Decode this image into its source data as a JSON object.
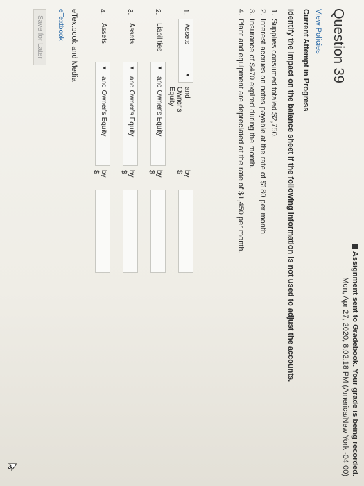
{
  "banner": {
    "line1": "Assignment sent to Gradebook. Your grade is being recorded.",
    "line2": "Mon, Apr 27, 2020, 8:02:18 PM (America/New York -04:00)"
  },
  "question": {
    "title": "Question 39",
    "view_policies": "View Policies",
    "attempt_status": "Current Attempt in Progress",
    "instruction": "Identify the impact on the balance sheet if the following information is not used to adjust the accounts.",
    "items": [
      {
        "num": "1.",
        "text": "Supplies consumed totaled $2,750."
      },
      {
        "num": "2.",
        "text": "Interest accrues on notes payable at the rate of $180 per month."
      },
      {
        "num": "3.",
        "text": "Insurance of $470 expired during the month."
      },
      {
        "num": "4.",
        "text": "Plant and equipment are depreciated at the rate of $1,450 per month."
      }
    ]
  },
  "answers": [
    {
      "num": "1.",
      "first": "Assets",
      "connector": "and Owner's Equity",
      "by": "by $",
      "value": ""
    },
    {
      "num": "2.",
      "first": "Liabilities",
      "connector": "and Owner's Equity",
      "by": "by $",
      "value": ""
    },
    {
      "num": "3.",
      "first": "Assets",
      "connector": "and Owner's Equity",
      "by": "by $",
      "value": ""
    },
    {
      "num": "4.",
      "first": "Assets",
      "connector": "and Owner's Equity",
      "by": "by $",
      "value": ""
    }
  ],
  "footer": {
    "media_title": "eTextbook and Media",
    "etextbook_link": "eTextbook",
    "save_label": "Save for Later"
  },
  "icons": {
    "lock": "lock-icon",
    "dropdown": "triangle-down-icon",
    "cursor": "mouse-pointer-icon"
  }
}
